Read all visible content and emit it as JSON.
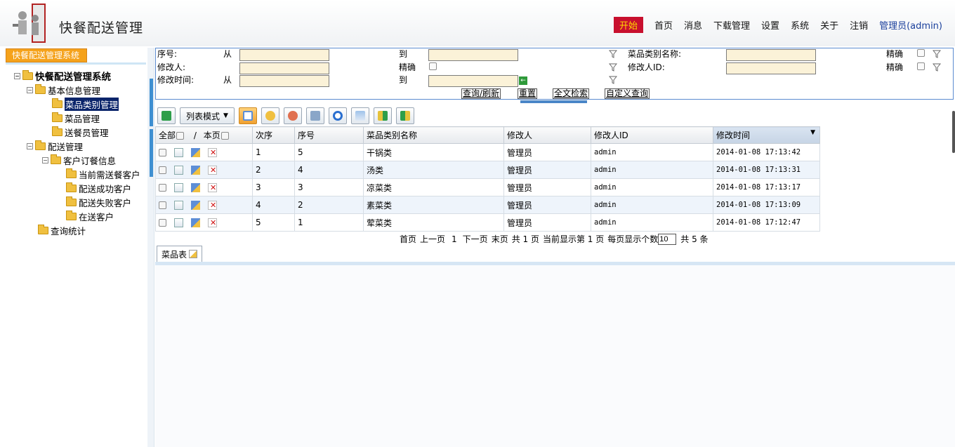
{
  "header": {
    "app_title": "快餐配送管理",
    "nav": {
      "start": "开始",
      "home": "首页",
      "messages": "消息",
      "downloads": "下载管理",
      "settings": "设置",
      "system": "系统",
      "about": "关于",
      "logout": "注销",
      "user": "管理员(admin)"
    }
  },
  "sidebar": {
    "tab_label": "快餐配送管理系统",
    "tree": {
      "root": "快餐配送管理系统",
      "basic_info": "基本信息管理",
      "dish_category": "菜品类别管理",
      "dish": "菜品管理",
      "courier": "送餐员管理",
      "delivery": "配送管理",
      "customer_orders": "客户订餐信息",
      "pending": "当前需送餐客户",
      "success": "配送成功客户",
      "failed": "配送失败客户",
      "in_transit": "在送客户",
      "stats": "查询统计"
    }
  },
  "search": {
    "seq_label": "序号:",
    "from_label": "从",
    "to_label": "到",
    "modifier_label": "修改人:",
    "exact_label": "精确",
    "modtime_label": "修改时间:",
    "category_label": "菜品类别名称:",
    "modifier_id_label": "修改人ID:",
    "query_button": "查询/刷新",
    "reset_button": "重置",
    "fulltext_button": "全文检索",
    "custom_button": "自定义查询"
  },
  "toolbar": {
    "mode_label": "列表模式"
  },
  "grid": {
    "select_all": "全部",
    "separator": "/",
    "this_page": "本页",
    "columns": [
      "次序",
      "序号",
      "菜品类别名称",
      "修改人",
      "修改人ID",
      "修改时间"
    ],
    "rows": [
      {
        "order": "1",
        "seq": "5",
        "name": "干锅类",
        "modifier": "管理员",
        "modifier_id": "admin",
        "time": "2014-01-08 17:13:42"
      },
      {
        "order": "2",
        "seq": "4",
        "name": "汤类",
        "modifier": "管理员",
        "modifier_id": "admin",
        "time": "2014-01-08 17:13:31"
      },
      {
        "order": "3",
        "seq": "3",
        "name": "凉菜类",
        "modifier": "管理员",
        "modifier_id": "admin",
        "time": "2014-01-08 17:13:17"
      },
      {
        "order": "4",
        "seq": "2",
        "name": "素菜类",
        "modifier": "管理员",
        "modifier_id": "admin",
        "time": "2014-01-08 17:13:09"
      },
      {
        "order": "5",
        "seq": "1",
        "name": "荤菜类",
        "modifier": "管理员",
        "modifier_id": "admin",
        "time": "2014-01-08 17:12:47"
      }
    ]
  },
  "pager": {
    "first": "首页",
    "prev": "上一页",
    "current": "1",
    "next": "下一页",
    "last": "末页",
    "total_pages": "共 1 页",
    "showing_page": "当前显示第 1 页",
    "per_page_label": "每页显示个数",
    "per_page_value": "10",
    "total_records": "共 5 条"
  },
  "bottom_tab": {
    "label": "菜品表"
  }
}
